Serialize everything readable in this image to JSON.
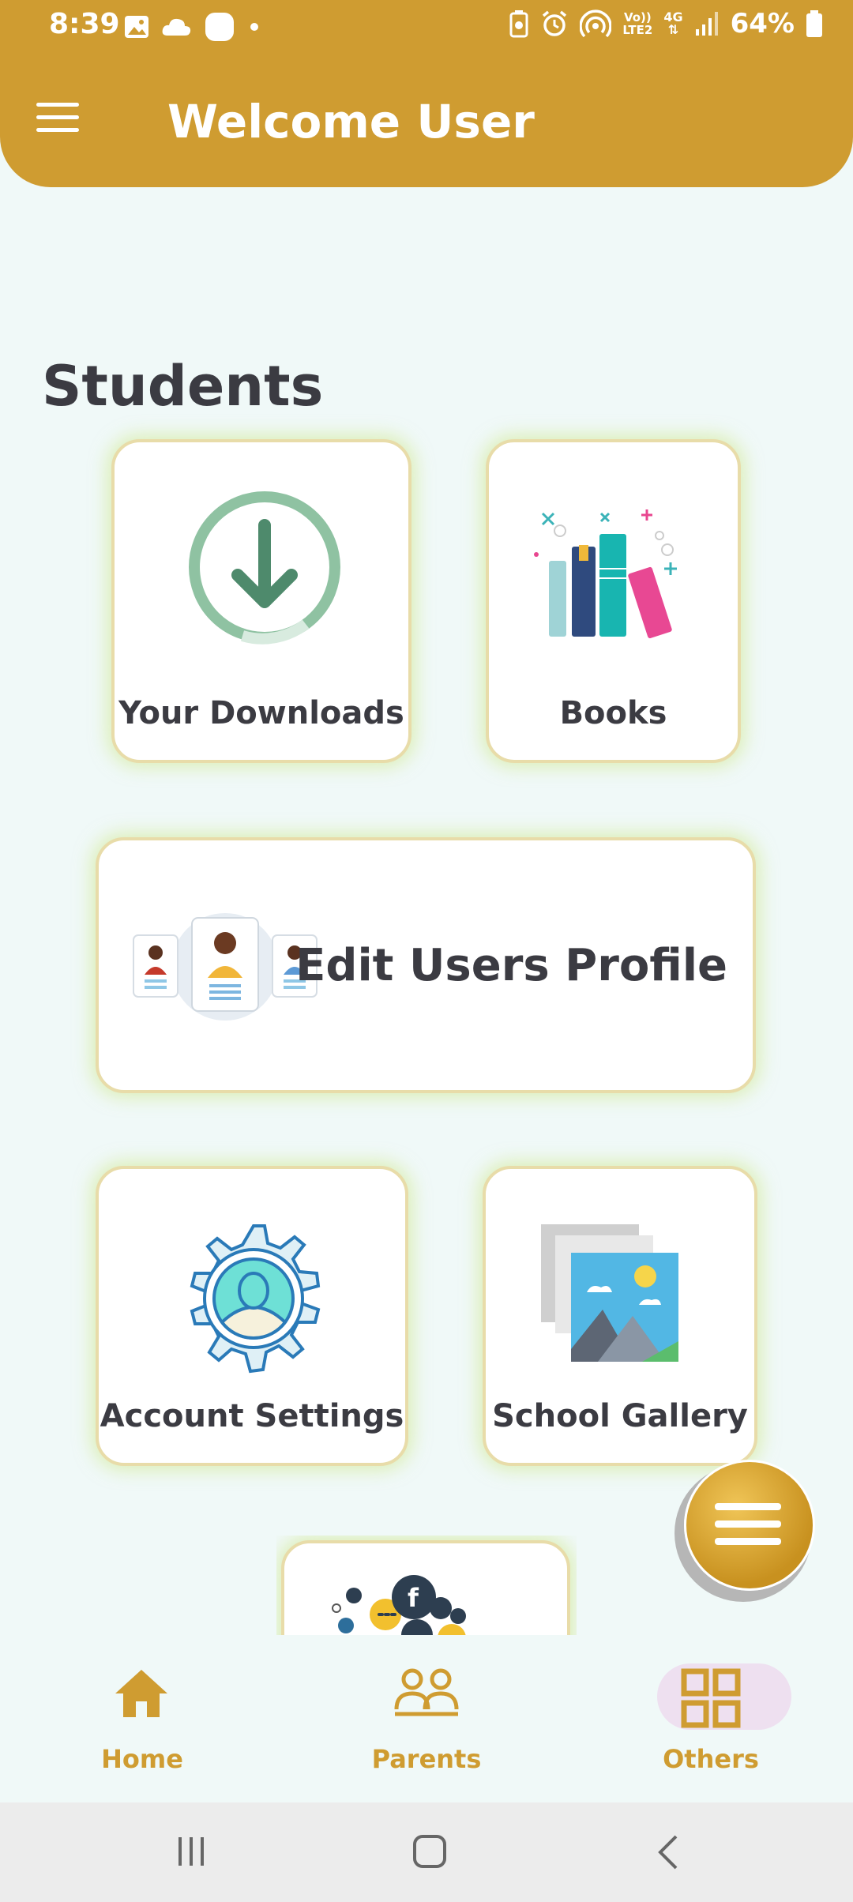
{
  "status_bar": {
    "time": "8:39",
    "network_top": "Vo))",
    "network_bottom": "LTE2",
    "network_type": "4G",
    "battery": "64%"
  },
  "header": {
    "title": "Welcome User"
  },
  "section": {
    "title": "Students"
  },
  "cards": {
    "downloads": "Your Downloads",
    "books": "Books",
    "edit_profile": "Edit Users Profile",
    "account_settings": "Account Settings",
    "gallery": "School Gallery"
  },
  "bottom_nav": {
    "home": "Home",
    "parents": "Parents",
    "others": "Others",
    "active": "Others"
  },
  "colors": {
    "accent": "#cf9c31",
    "background": "#f0f9f8",
    "card_border": "#e8dca9"
  }
}
